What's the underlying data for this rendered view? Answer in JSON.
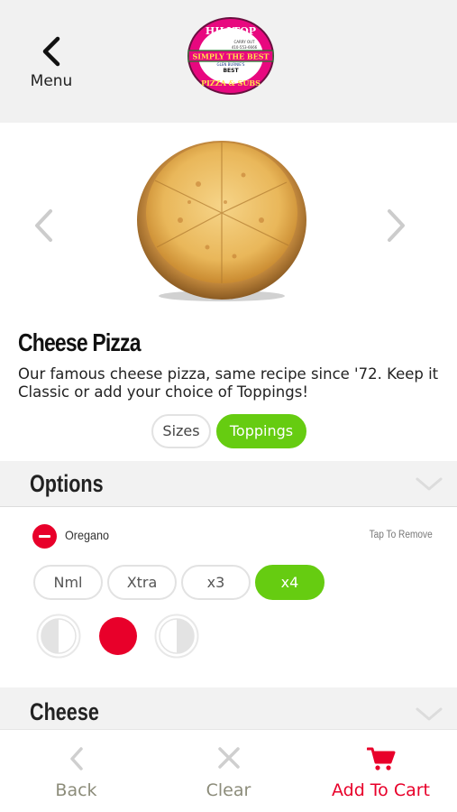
{
  "header": {
    "back_label": "Menu",
    "logo": {
      "brand": "HILLTOP",
      "slogan": "SIMPLY THE BEST",
      "since": "CARRY OUT",
      "phone": "410-553-6666",
      "award_line1": "GLEN BURNIE'S",
      "award_line2": "BEST",
      "sub": "PIZZA & SUBS"
    }
  },
  "product": {
    "title": "Cheese Pizza",
    "description": "Our famous cheese pizza, same recipe since '72. Keep it Classic or add your choice of Toppings!"
  },
  "tabs": {
    "sizes": "Sizes",
    "toppings": "Toppings",
    "selected": "toppings"
  },
  "options": {
    "title": "Options",
    "item_name": "Oregano",
    "remove_hint": "Tap To Remove",
    "amounts": [
      "Nml",
      "Xtra",
      "x3",
      "x4"
    ],
    "selected_amount": "x4",
    "coverage_selected": "whole"
  },
  "next_section": {
    "title": "Cheese"
  },
  "bottom": {
    "back": "Back",
    "clear": "Clear",
    "add_to_cart": "Add To Cart"
  },
  "colors": {
    "accent_green": "#66cc11",
    "accent_red": "#e8002a",
    "header_bg": "#f1f1f1"
  }
}
